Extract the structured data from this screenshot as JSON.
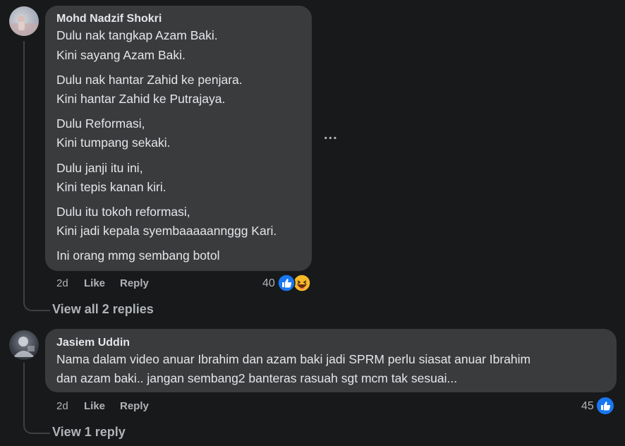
{
  "comments": [
    {
      "author": "Mohd Nadzif Shokri",
      "lines": [
        "Dulu nak tangkap Azam Baki.",
        "Kini sayang Azam Baki.",
        "Dulu nak hantar Zahid ke penjara.",
        "Kini hantar Zahid ke Putrajaya.",
        "Dulu Reformasi,",
        "Kini tumpang sekaki.",
        "Dulu janji itu ini,",
        "Kini tepis kanan kiri.",
        "Dulu itu tokoh reformasi,",
        "Kini jadi kepala syembaaaaannggg Kari.",
        "Ini orang mmg sembang botol"
      ],
      "time": "2d",
      "like_label": "Like",
      "reply_label": "Reply",
      "reaction_count": "40",
      "reactions": [
        "like-icon",
        "haha-icon"
      ],
      "replies_link": "View all 2 replies",
      "more_label": "..."
    },
    {
      "author": "Jasiem Uddin",
      "lines": [
        "Nama dalam video anuar Ibrahim dan azam baki jadi SPRM perlu siasat anuar Ibrahim",
        "dan azam baki.. jangan sembang2 banteras rasuah sgt mcm tak sesuai..."
      ],
      "time": "2d",
      "like_label": "Like",
      "reply_label": "Reply",
      "reaction_count": "45",
      "reactions": [
        "like-icon"
      ],
      "replies_link": "View 1 reply"
    }
  ],
  "colors": {
    "background": "#18191a",
    "bubble": "#3a3b3c",
    "text": "#e4e6eb",
    "secondary_text": "#b0b3b8",
    "like_blue": "#1877f2",
    "haha_yellow": "#f7b928"
  }
}
